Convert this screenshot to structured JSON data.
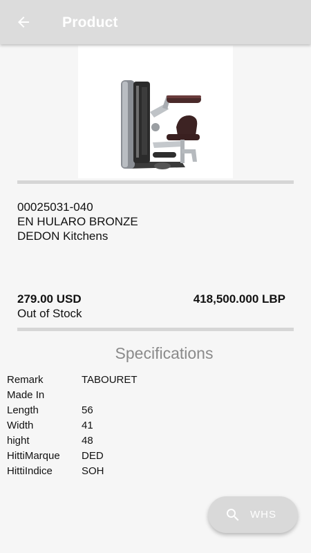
{
  "appbar": {
    "title": "Product",
    "back_icon": "arrow-back-icon",
    "background": "#dcdcdc"
  },
  "product": {
    "code": "00025031-040",
    "name": "EN HULARO BRONZE",
    "brand": "DEDON Kitchens",
    "price_usd": "279.00 USD",
    "price_lbp": "418,500.000 LBP",
    "stock_status": "Out of Stock"
  },
  "specifications": {
    "title": "Specifications",
    "rows": [
      {
        "key": "Remark",
        "value": "TABOURET"
      },
      {
        "key": "Made In",
        "value": ""
      },
      {
        "key": "Length",
        "value": "56"
      },
      {
        "key": "Width",
        "value": "41"
      },
      {
        "key": "hight",
        "value": "48"
      },
      {
        "key": "HittiMarque",
        "value": "DED"
      },
      {
        "key": "HittiIndice",
        "value": "SOH"
      }
    ]
  },
  "fab": {
    "label": "WHS",
    "icon": "search-icon"
  }
}
